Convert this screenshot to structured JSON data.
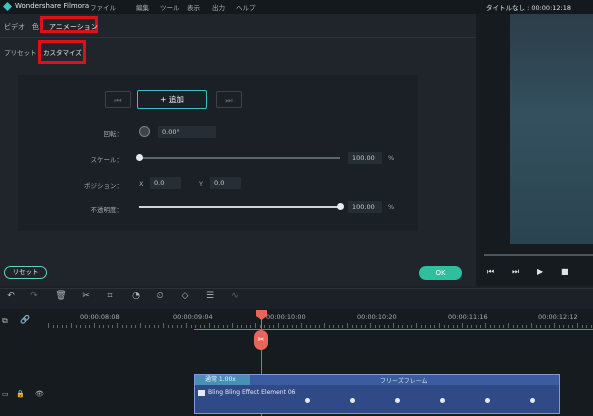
{
  "window": {
    "app_title": "Wondershare Filmora",
    "document_title": "タイトルなし : 00:00:12:18"
  },
  "menu": [
    "ファイル",
    "編集",
    "ツール",
    "表示",
    "出力",
    "ヘルプ"
  ],
  "tabs": {
    "video": "ビデオ",
    "other": "色",
    "animation": "アニメーション"
  },
  "subtabs": {
    "preset": "プリセット",
    "customize": "カスタマイズ"
  },
  "keyframe": {
    "prev": "⏮",
    "add_label": "+ 追加",
    "next": "⏭"
  },
  "properties": {
    "rotation": {
      "label": "回転：",
      "value": "0.00°"
    },
    "scale": {
      "label": "スケール：",
      "value": "100.00",
      "unit": "%",
      "level": 0.0
    },
    "position": {
      "label": "ポジション：",
      "x_label": "X",
      "x_value": "0.0",
      "y_label": "Y",
      "y_value": "0.0"
    },
    "opacity": {
      "label": "不透明度：",
      "value": "100.00",
      "unit": "%",
      "level": 1.0
    }
  },
  "buttons": {
    "reset": "リセット",
    "ok": "OK"
  },
  "preview_controls": [
    "⏮",
    "⏭",
    "▶",
    "■"
  ],
  "toolbar_icons": [
    "undo-icon",
    "redo-icon",
    "delete-icon",
    "cut-icon",
    "crop-icon",
    "speed-icon",
    "timer-icon",
    "keyframe-icon",
    "adjust-icon",
    "audio-wave-icon"
  ],
  "timeline": {
    "timecodes": [
      "00:00:08:08",
      "00:00:09:04",
      "00:00:10:00",
      "00:00:10:20",
      "00:00:11:16",
      "00:00:12:12"
    ],
    "clip": {
      "speed": "通常 1.00x",
      "freeze_label": "フリーズフレーム",
      "name": "Bling Bling Effect Element 06"
    }
  },
  "colors": {
    "accent": "#2fbf9e",
    "highlight_box": "#e0101b",
    "playhead": "#e05a4a",
    "clip": "#2f4a86"
  }
}
